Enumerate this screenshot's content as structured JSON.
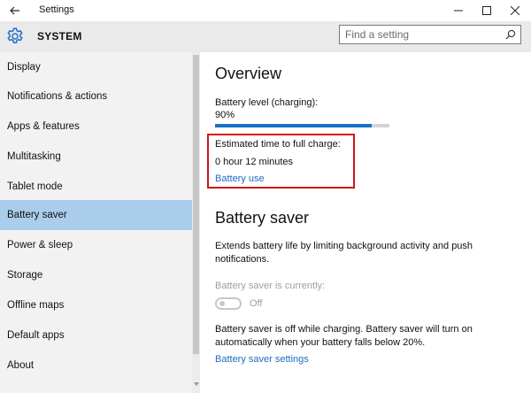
{
  "window": {
    "title": "Settings"
  },
  "header": {
    "title": "SYSTEM",
    "search_placeholder": "Find a setting"
  },
  "sidebar": {
    "items": [
      {
        "label": "Display"
      },
      {
        "label": "Notifications & actions"
      },
      {
        "label": "Apps & features"
      },
      {
        "label": "Multitasking"
      },
      {
        "label": "Tablet mode"
      },
      {
        "label": "Battery saver",
        "selected": true
      },
      {
        "label": "Power & sleep"
      },
      {
        "label": "Storage"
      },
      {
        "label": "Offline maps"
      },
      {
        "label": "Default apps"
      },
      {
        "label": "About"
      }
    ]
  },
  "overview": {
    "title": "Overview",
    "battery_level_label": "Battery level (charging):",
    "battery_level_value": "90%",
    "battery_level_percent": 90,
    "estimated_label": "Estimated time to full charge:",
    "estimated_value": "0 hour 12 minutes",
    "battery_use_link": "Battery use"
  },
  "battery_saver": {
    "title": "Battery saver",
    "description": "Extends battery life by limiting background activity and push notifications.",
    "currently_label": "Battery saver is currently:",
    "toggle_state": "Off",
    "note": "Battery saver is off while charging. Battery saver will turn on automatically when your battery falls below 20%.",
    "settings_link": "Battery saver settings"
  },
  "colors": {
    "accent": "#1a6fc6",
    "selected_nav": "#a9cdea",
    "highlight_box": "#d1131c",
    "link": "#1f6bc0"
  }
}
